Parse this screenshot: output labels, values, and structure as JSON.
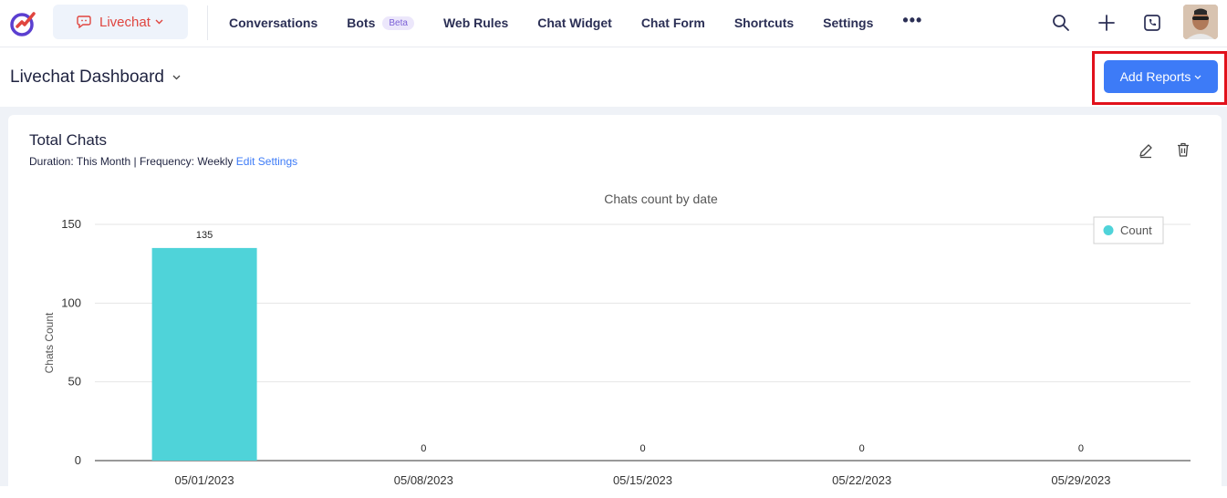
{
  "app": {
    "switcher_label": "Livechat"
  },
  "nav": {
    "items": [
      "Conversations",
      "Bots",
      "Web Rules",
      "Chat Widget",
      "Chat Form",
      "Shortcuts",
      "Settings"
    ],
    "bots_badge": "Beta",
    "more": "•••"
  },
  "header": {
    "dashboard_title": "Livechat Dashboard",
    "add_reports_label": "Add Reports"
  },
  "card": {
    "title": "Total Chats",
    "meta": "Duration: This Month | Frequency: Weekly",
    "edit_settings": "Edit Settings"
  },
  "colors": {
    "accent": "#3d7bf7",
    "brand_red": "#e0453f",
    "bar": "#4fd3d9",
    "highlight": "#e1111b"
  },
  "chart_data": {
    "type": "bar",
    "title": "Chats count by date",
    "ylabel": "Chats Count",
    "xlabel": "",
    "categories": [
      "05/01/2023",
      "05/08/2023",
      "05/15/2023",
      "05/22/2023",
      "05/29/2023"
    ],
    "series": [
      {
        "name": "Count",
        "values": [
          135,
          0,
          0,
          0,
          0
        ]
      }
    ],
    "data_labels": [
      "135",
      "0",
      "0",
      "0",
      "0"
    ],
    "ylim": [
      0,
      150
    ],
    "yticks": [
      0,
      50,
      100,
      150
    ],
    "grid": true,
    "legend": "top-right"
  }
}
